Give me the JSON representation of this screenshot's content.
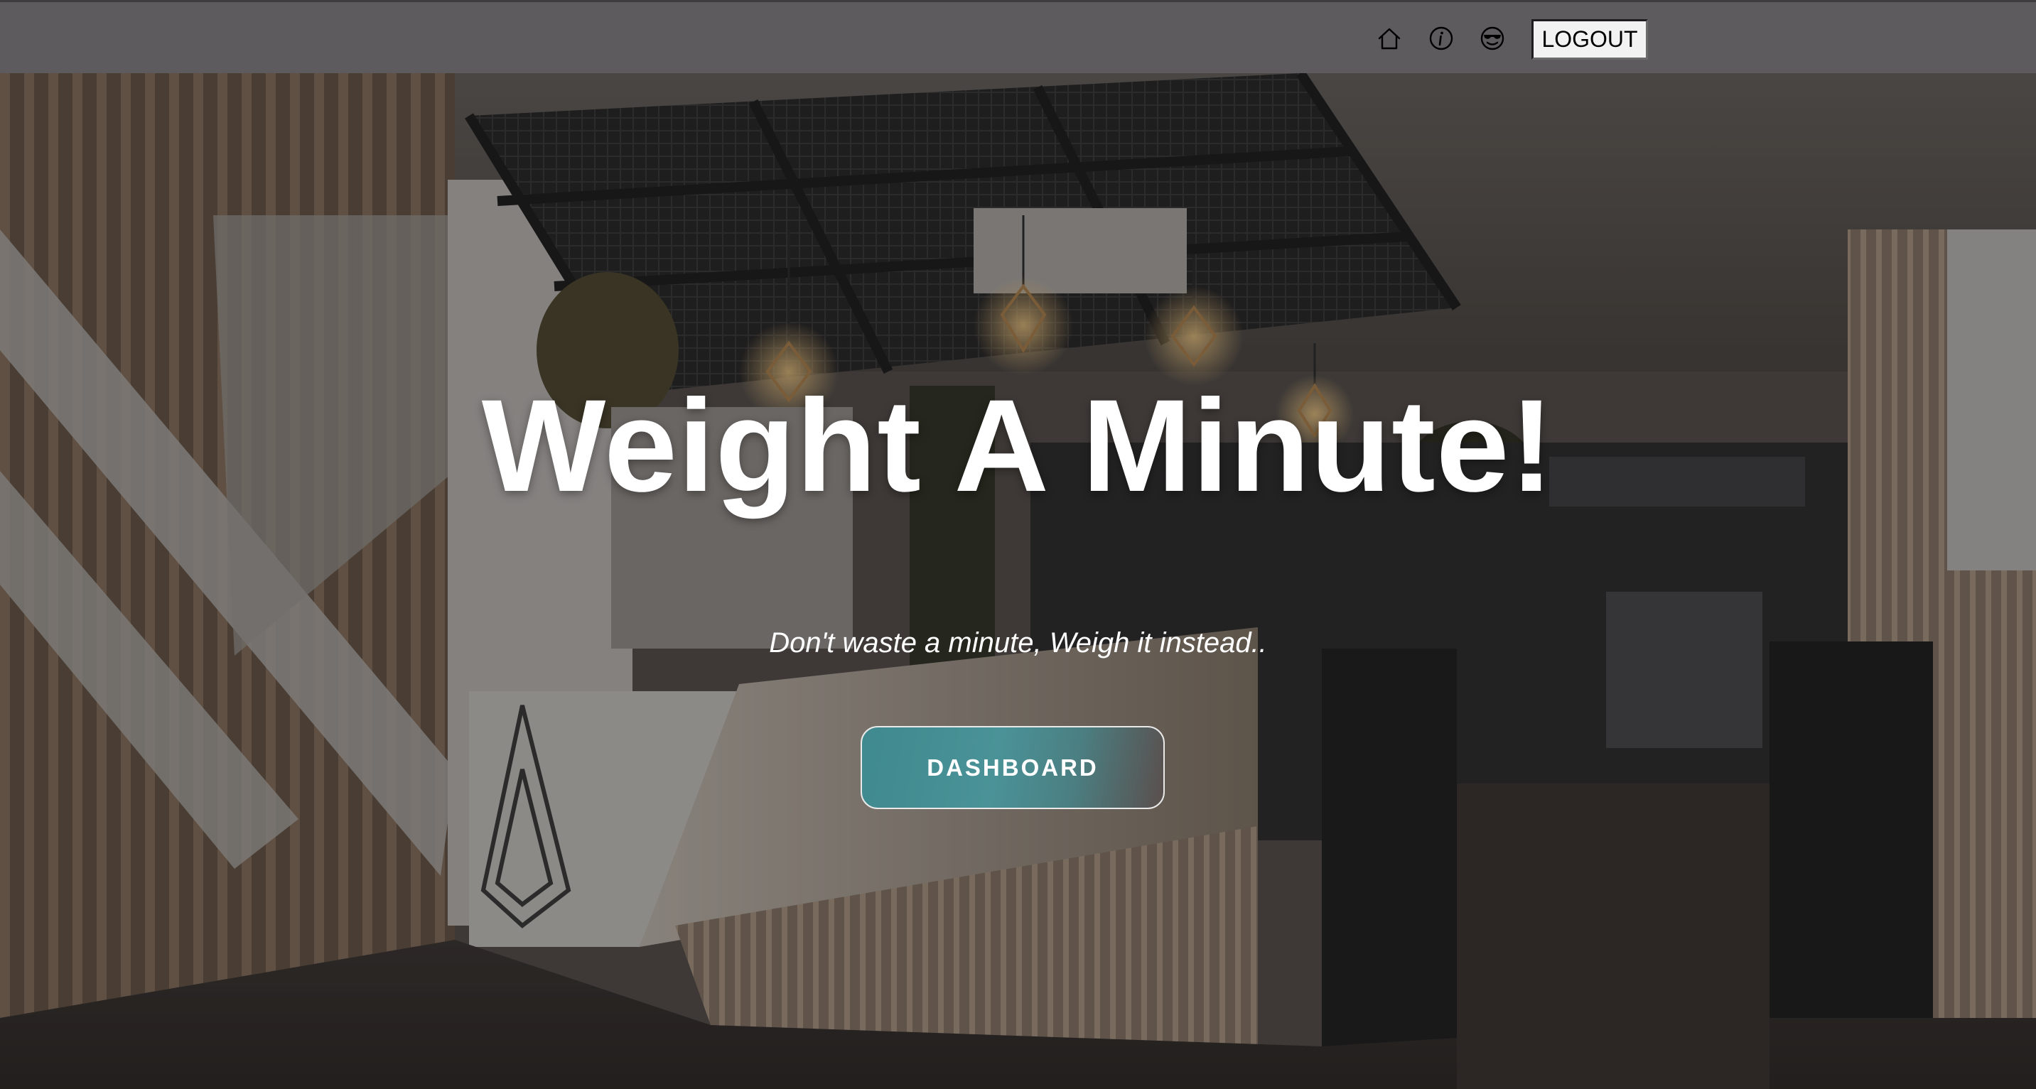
{
  "nav": {
    "icons": [
      "home-icon",
      "info-icon",
      "cool-face-icon"
    ],
    "logout_label": "LOGOUT"
  },
  "hero": {
    "title": "Weight A Minute!",
    "subtitle": "Don't waste a minute, Weigh it instead..",
    "cta_label": "DASHBOARD"
  },
  "colors": {
    "topbar": "#5d5b5d",
    "cta_start": "#3f8a8f",
    "cta_end": "#5a4f4d",
    "text": "#ffffff"
  }
}
